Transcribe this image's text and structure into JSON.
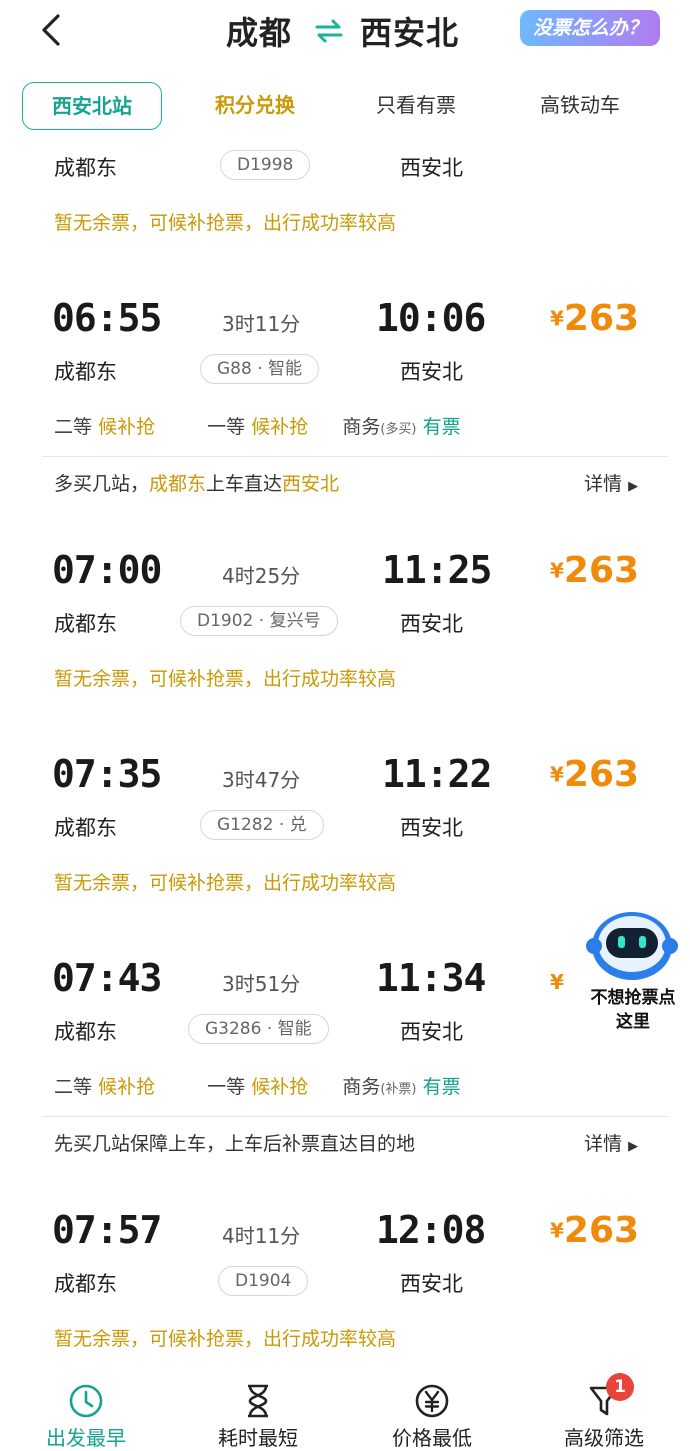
{
  "header": {
    "from": "成都",
    "to": "西安北",
    "help_label": "没票怎么办？"
  },
  "filters": [
    {
      "label": "西安北站",
      "active": true
    },
    {
      "label": "积分兑换"
    },
    {
      "label": "只看有票"
    },
    {
      "label": "高铁动车"
    }
  ],
  "partial_row": {
    "from_station": "成都东",
    "train": "D1998",
    "to_station": "西安北",
    "status": "暂无余票，可候补抢票，出行成功率较高"
  },
  "trains": [
    {
      "dep": "06:55",
      "duration": "3时11分",
      "arr": "10:06",
      "currency": "¥",
      "price": "263",
      "from_station": "成都东",
      "train": "G88 · 智能",
      "to_station": "西安北",
      "seats": {
        "second": "二等",
        "second_status": "候补抢",
        "first": "一等",
        "first_status": "候补抢",
        "business": "商务",
        "business_note": "(多买)",
        "business_status": "有票"
      },
      "hint_parts": [
        "多买几站，",
        "成都东",
        "上车直达",
        "西安北"
      ],
      "detail": "详情"
    },
    {
      "dep": "07:00",
      "duration": "4时25分",
      "arr": "11:25",
      "currency": "¥",
      "price": "263",
      "from_station": "成都东",
      "train": "D1902 · 复兴号",
      "to_station": "西安北",
      "status": "暂无余票，可候补抢票，出行成功率较高"
    },
    {
      "dep": "07:35",
      "duration": "3时47分",
      "arr": "11:22",
      "currency": "¥",
      "price": "263",
      "from_station": "成都东",
      "train": "G1282 · 兑",
      "to_station": "西安北",
      "status": "暂无余票，可候补抢票，出行成功率较高"
    },
    {
      "dep": "07:43",
      "duration": "3时51分",
      "arr": "11:34",
      "currency": "¥",
      "from_station": "成都东",
      "train": "G3286 · 智能",
      "to_station": "西安北",
      "seats": {
        "second": "二等",
        "second_status": "候补抢",
        "first": "一等",
        "first_status": "候补抢",
        "business": "商务",
        "business_note": "(补票)",
        "business_status": "有票"
      },
      "hint": "先买几站保障上车，上车后补票直达目的地",
      "detail": "详情"
    },
    {
      "dep": "07:57",
      "duration": "4时11分",
      "arr": "12:08",
      "currency": "¥",
      "price": "263",
      "from_station": "成都东",
      "train": "D1904",
      "to_station": "西安北",
      "status": "暂无余票，可候补抢票，出行成功率较高"
    }
  ],
  "assistant": {
    "text_line1": "不想抢票点",
    "text_line2": "这里"
  },
  "bottom_nav": [
    {
      "label": "出发最早",
      "icon": "clock-icon",
      "active": true
    },
    {
      "label": "耗时最短",
      "icon": "hourglass-icon"
    },
    {
      "label": "价格最低",
      "icon": "yen-icon"
    },
    {
      "label": "高级筛选",
      "icon": "filter-icon",
      "badge": "1"
    }
  ],
  "colors": {
    "accent": "#17a391",
    "price": "#f08a0a",
    "waitlist": "#c99a06",
    "available": "#13a28a"
  }
}
